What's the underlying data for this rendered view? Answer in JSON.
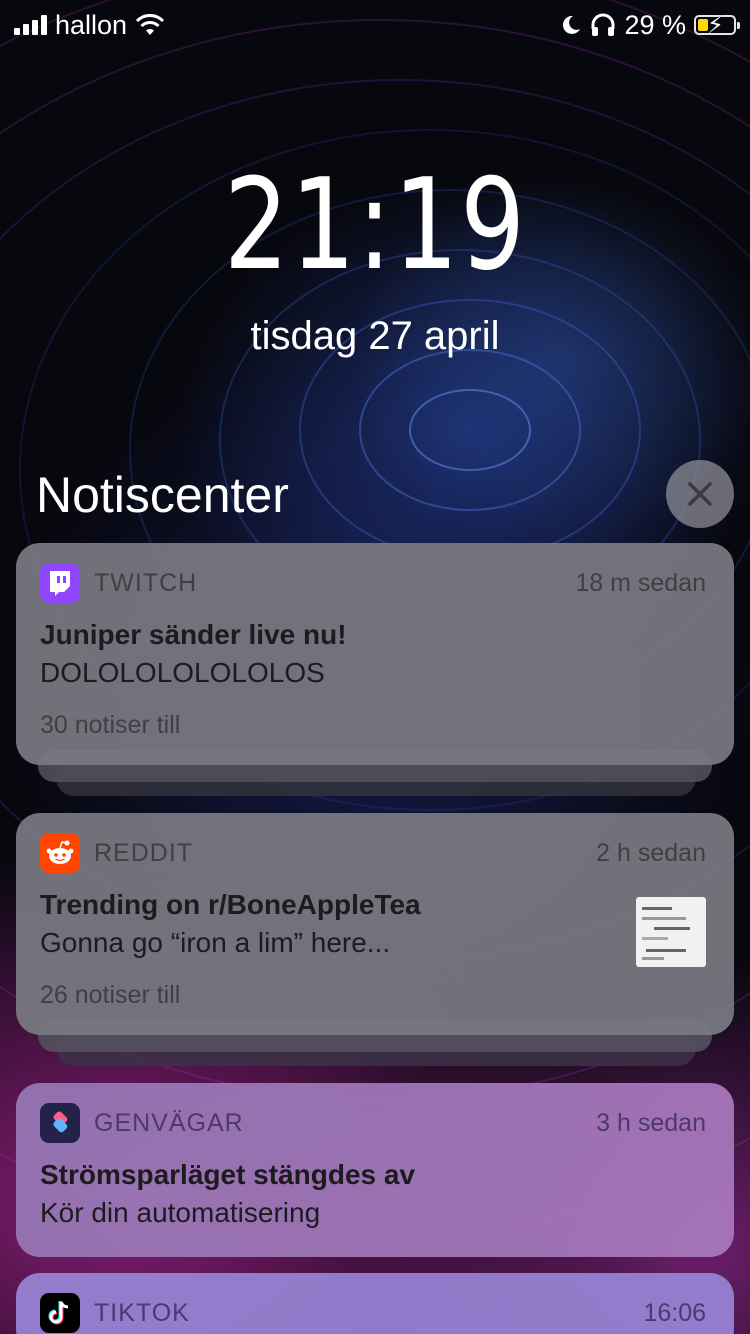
{
  "status_bar": {
    "carrier": "hallon",
    "battery_percent": "29 %",
    "battery_level": 0.29,
    "icons": [
      "signal-icon",
      "wifi-icon",
      "moon-icon",
      "headphones-icon",
      "battery-charging-icon"
    ]
  },
  "lock_screen": {
    "time": "21:19",
    "date": "tisdag 27 april"
  },
  "notification_center": {
    "title": "Notiscenter",
    "clear_icon": "close-icon"
  },
  "notifications": [
    {
      "app": "TWITCH",
      "icon": "twitch-icon",
      "time": "18 m sedan",
      "title": "Juniper sänder live nu!",
      "body": "DOLOLOLOLOLOLOS",
      "more": "30 notiser till"
    },
    {
      "app": "REDDIT",
      "icon": "reddit-icon",
      "time": "2 h sedan",
      "title": "Trending on r/BoneAppleTea",
      "body": "Gonna go “iron a lim” here...",
      "more": "26 notiser till"
    },
    {
      "app": "GENVÄGAR",
      "icon": "shortcuts-icon",
      "time": "3 h sedan",
      "title": "Strömsparläget stängdes av",
      "body": "Kör din automatisering"
    },
    {
      "app": "TIKTOK",
      "icon": "tiktok-icon",
      "time": "16:06"
    }
  ],
  "colors": {
    "twitch": "#9146ff",
    "reddit": "#ff4500",
    "shortcuts": "#2b2b6e",
    "tiktok": "#000000"
  }
}
